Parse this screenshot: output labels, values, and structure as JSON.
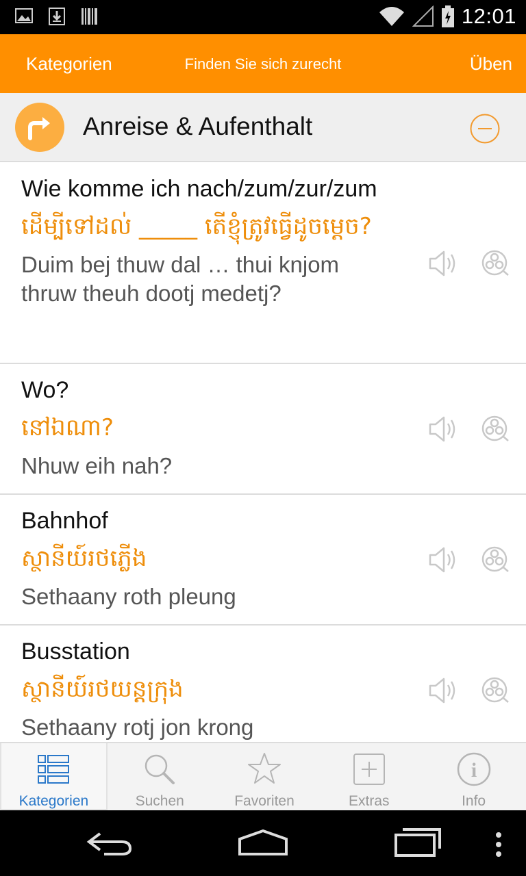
{
  "status_bar": {
    "time": "12:01"
  },
  "action_bar": {
    "left": "Kategorien",
    "center": "Finden Sie sich zurecht",
    "right": "Üben"
  },
  "category": {
    "title": "Anreise & Aufenthalt"
  },
  "phrases": [
    {
      "german": "Wie komme ich nach/zum/zur/zum",
      "khmer": "ដើម្បីទៅដល់ _____ តើខ្ញុំត្រូវធ្វើដូចម្ដេច?",
      "transliteration": "Duim bej thuw dal … thui knjom thruw theuh dootj medetj?"
    },
    {
      "german": "Wo?",
      "khmer": "នៅឯណា?",
      "transliteration": "Nhuw eih nah?"
    },
    {
      "german": "Bahnhof",
      "khmer": "ស្ថានីយ៍រថភ្លើង",
      "transliteration": "Sethaany roth pleung"
    },
    {
      "german": "Busstation",
      "khmer": "ស្ថានីយ៍រថយន្តក្រុង",
      "transliteration": "Sethaany rotj jon krong"
    }
  ],
  "tabs": [
    {
      "label": "Kategorien",
      "icon": "list-icon",
      "active": true
    },
    {
      "label": "Suchen",
      "icon": "search-icon"
    },
    {
      "label": "Favoriten",
      "icon": "star-icon"
    },
    {
      "label": "Extras",
      "icon": "plus-box-icon"
    },
    {
      "label": "Info",
      "icon": "info-icon"
    }
  ],
  "colors": {
    "accent": "#ff8f00",
    "khmer_text": "#ee8e0b",
    "active_tab": "#2a78c9"
  }
}
